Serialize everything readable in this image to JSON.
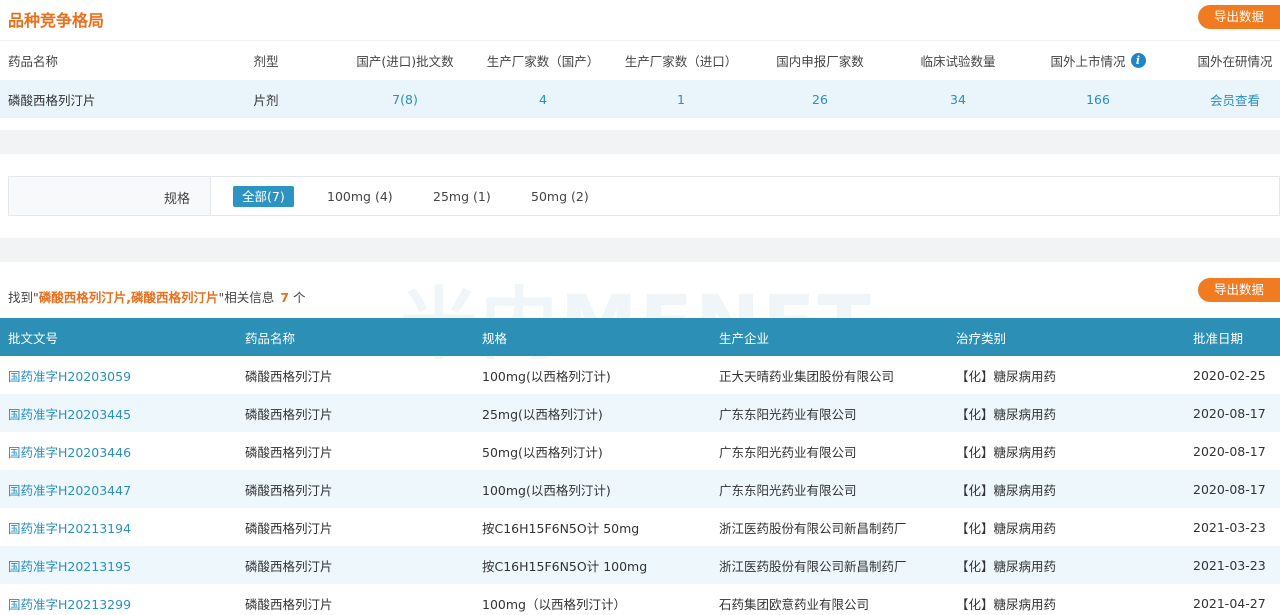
{
  "section": {
    "title": "品种竞争格局",
    "export_label": "导出数据"
  },
  "summary": {
    "headers": [
      "药品名称",
      "剂型",
      "国产(进口)批文数",
      "生产厂家数（国产）",
      "生产厂家数（进口）",
      "国内申报厂家数",
      "临床试验数量",
      "国外上市情况",
      "国外在研情况"
    ],
    "row": [
      "磷酸西格列汀片",
      "片剂",
      "7(8)",
      "4",
      "1",
      "26",
      "34",
      "166",
      "会员查看"
    ]
  },
  "filter": {
    "label": "规格",
    "chips": [
      "全部(7)",
      "100mg (4)",
      "25mg (1)",
      "50mg (2)"
    ],
    "active_index": 0
  },
  "found": {
    "prefix": "找到\"",
    "keyword": "磷酸西格列汀片,磷酸西格列汀片",
    "middle": "\"相关信息",
    "count": "7",
    "suffix": "个"
  },
  "watermark": "米内MENET",
  "list": {
    "export_label": "导出数据",
    "headers": [
      "批文文号",
      "药品名称",
      "规格",
      "生产企业",
      "治疗类别",
      "批准日期"
    ],
    "rows": [
      [
        "国药准字H20203059",
        "磷酸西格列汀片",
        "100mg(以西格列汀计)",
        "正大天晴药业集团股份有限公司",
        "【化】糖尿病用药",
        "2020-02-25"
      ],
      [
        "国药准字H20203445",
        "磷酸西格列汀片",
        "25mg(以西格列汀计)",
        "广东东阳光药业有限公司",
        "【化】糖尿病用药",
        "2020-08-17"
      ],
      [
        "国药准字H20203446",
        "磷酸西格列汀片",
        "50mg(以西格列汀计)",
        "广东东阳光药业有限公司",
        "【化】糖尿病用药",
        "2020-08-17"
      ],
      [
        "国药准字H20203447",
        "磷酸西格列汀片",
        "100mg(以西格列汀计)",
        "广东东阳光药业有限公司",
        "【化】糖尿病用药",
        "2020-08-17"
      ],
      [
        "国药准字H20213194",
        "磷酸西格列汀片",
        "按C16H15F6N5O计 50mg",
        "浙江医药股份有限公司新昌制药厂",
        "【化】糖尿病用药",
        "2021-03-23"
      ],
      [
        "国药准字H20213195",
        "磷酸西格列汀片",
        "按C16H15F6N5O计 100mg",
        "浙江医药股份有限公司新昌制药厂",
        "【化】糖尿病用药",
        "2021-03-23"
      ],
      [
        "国药准字H20213299",
        "磷酸西格列汀片",
        "100mg（以西格列汀计）",
        "石药集团欧意药业有限公司",
        "【化】糖尿病用药",
        "2021-04-27"
      ]
    ]
  },
  "icons": {
    "info": "info-icon"
  },
  "colors": {
    "accent_orange": "#f07b21",
    "header_blue": "#2b8fb6",
    "link_blue": "#2a8fbf"
  }
}
